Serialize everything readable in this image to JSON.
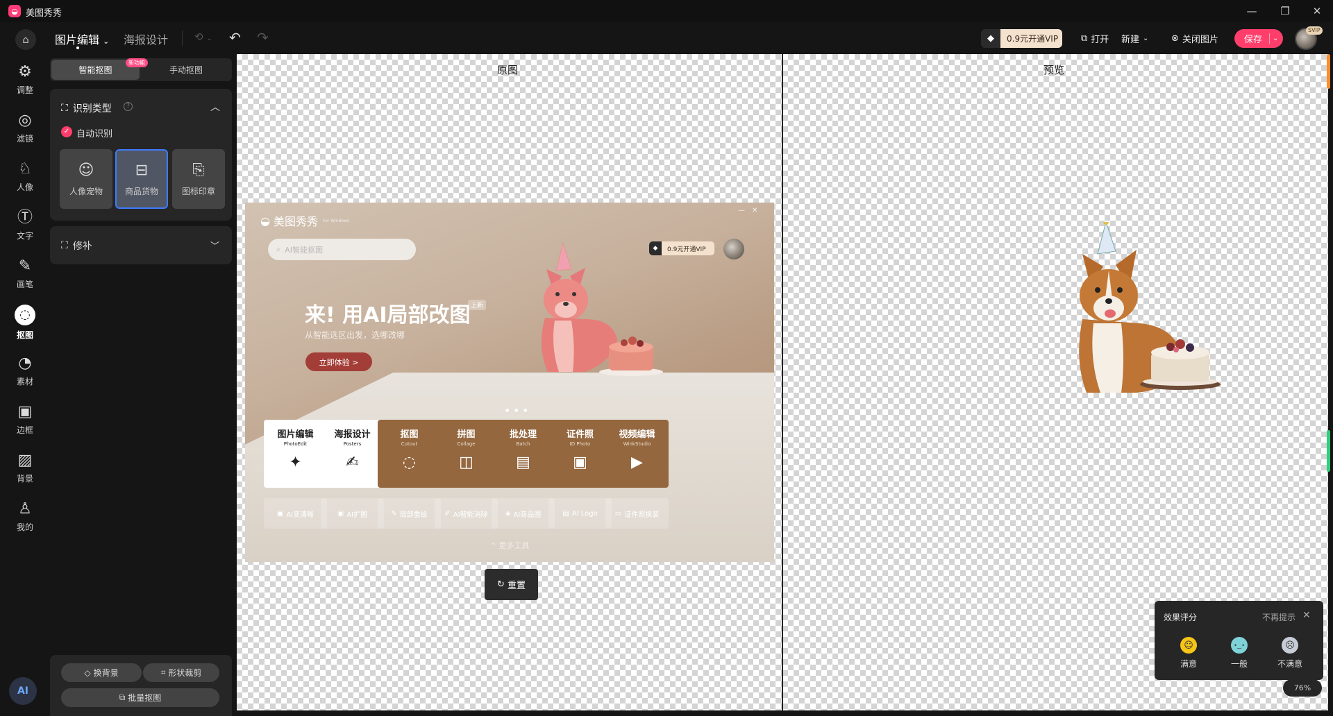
{
  "app": {
    "name": "美图秀秀",
    "logo_icon": "meitu-logo-icon"
  },
  "window_controls": {
    "minimize": "—",
    "maximize": "❐",
    "close": "✕"
  },
  "topbar": {
    "tabs": [
      {
        "label": "图片编辑",
        "active": true
      },
      {
        "label": "海报设计",
        "active": false
      }
    ],
    "vip": "0.9元开通VIP",
    "open": "打开",
    "new": "新建",
    "close_image": "关闭图片",
    "save": "保存",
    "avatar_badge": "SVIP"
  },
  "nav": [
    {
      "label": "调整",
      "icon": "⚙"
    },
    {
      "label": "滤镜",
      "icon": "◎"
    },
    {
      "label": "人像",
      "icon": "♘"
    },
    {
      "label": "文字",
      "icon": "Ⓣ"
    },
    {
      "label": "画笔",
      "icon": "✎"
    },
    {
      "label": "抠图",
      "icon": "◌",
      "active": true
    },
    {
      "label": "素材",
      "icon": "◔"
    },
    {
      "label": "边框",
      "icon": "▣"
    },
    {
      "label": "背景",
      "icon": "▨"
    },
    {
      "label": "我的",
      "icon": "♙"
    }
  ],
  "ai_button": "AI",
  "panel": {
    "subtabs": {
      "smart": "智能抠图",
      "manual": "手动抠图",
      "badge": "新功能"
    },
    "recognition": {
      "title": "识别类型",
      "auto_label": "自动识别",
      "types": [
        {
          "label": "人像宠物",
          "icon": "person-pet-icon"
        },
        {
          "label": "商品货物",
          "icon": "goods-icon",
          "selected": true
        },
        {
          "label": "图标印章",
          "icon": "stamp-icon"
        }
      ]
    },
    "repair": {
      "title": "修补"
    },
    "bottom": {
      "change_bg": "换背景",
      "shape_crop": "形状裁剪",
      "batch_cutout": "批量抠图"
    }
  },
  "canvas": {
    "original_label": "原图",
    "preview_label": "预览",
    "reset": "重置",
    "zoom": "76%"
  },
  "shot": {
    "brand": "美图秀秀",
    "brand_small": "For Windows",
    "search_placeholder": "AI智能抠图",
    "vip": "0.9元开通VIP",
    "headline": "来! 用AI局部改图",
    "new_badge": "上新",
    "subline": "从智能选区出发，选哪改哪",
    "try": "立即体验 >",
    "cards": [
      {
        "title": "图片编辑",
        "sub": "PhotoEdit",
        "icon": "✦",
        "style": "light"
      },
      {
        "title": "海报设计",
        "sub": "Posters",
        "icon": "✍",
        "style": "light"
      },
      {
        "title": "抠图",
        "sub": "Cutout",
        "icon": "◌",
        "style": "dark"
      },
      {
        "title": "拼图",
        "sub": "Collage",
        "icon": "◫",
        "style": "dark"
      },
      {
        "title": "批处理",
        "sub": "Batch",
        "icon": "▤",
        "style": "dark"
      },
      {
        "title": "证件照",
        "sub": "ID Photo",
        "icon": "▣",
        "style": "dark"
      },
      {
        "title": "视频编辑",
        "sub": "WinkStudio",
        "icon": "▶",
        "style": "dark"
      }
    ],
    "tools": [
      "AI变清晰",
      "AI扩图",
      "局部重绘",
      "AI智能消除",
      "AI商品图",
      "AI Logo",
      "证件照换装"
    ],
    "more": "更多工具"
  },
  "rating": {
    "title": "效果评分",
    "dismiss": "不再提示",
    "options": [
      {
        "label": "满意",
        "face": "☺",
        "color": "#f5c518"
      },
      {
        "label": "一般",
        "face": "•‿•",
        "color": "#7fd3d8"
      },
      {
        "label": "不满意",
        "face": "☹",
        "color": "#c7cdd6"
      }
    ]
  }
}
